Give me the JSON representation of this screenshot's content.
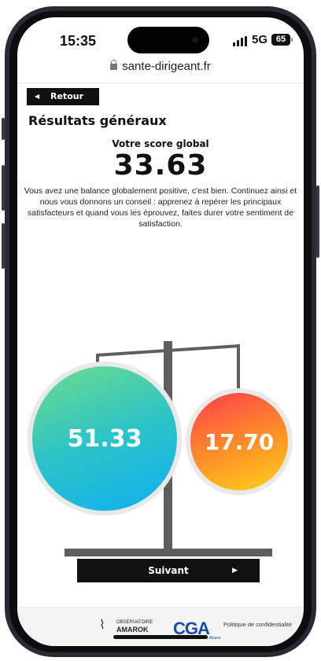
{
  "status_bar": {
    "time": "15:35",
    "network": "5G",
    "battery": "65"
  },
  "browser": {
    "url": "sante-dirigeant.fr"
  },
  "page": {
    "back_label": "Retour",
    "title": "Résultats généraux",
    "score_label": "Votre score global",
    "score_value": "33.63",
    "description": "Vous avez une balance globalement positive, c'est bien. Continuez ainsi et nous vous donnons un conseil : apprenez à repérer les principaux satisfacteurs et quand vous les éprouvez, faites durer votre sentiment de satisfaction.",
    "left_score": "51.33",
    "right_score": "17.70",
    "next_label": "Suivant"
  },
  "footer": {
    "observatoire_line1": "OBSERVATOIRE",
    "observatoire_line2": "AMAROK",
    "cga_logo": "CGA",
    "cga_subtitle": "Centre de Gestion Alsace",
    "privacy_link": "Politique de confidentialité"
  },
  "colors": {
    "positive_gradient": [
      "#6fdc8c",
      "#2cc3c7",
      "#0fb0f0"
    ],
    "negative_gradient": [
      "#ff3d4f",
      "#ff8a2a",
      "#ffd21a"
    ],
    "button_bg": "#111111"
  },
  "icons": {
    "back": "triangle-left-icon",
    "next": "triangle-right-icon",
    "lock": "lock-icon"
  }
}
